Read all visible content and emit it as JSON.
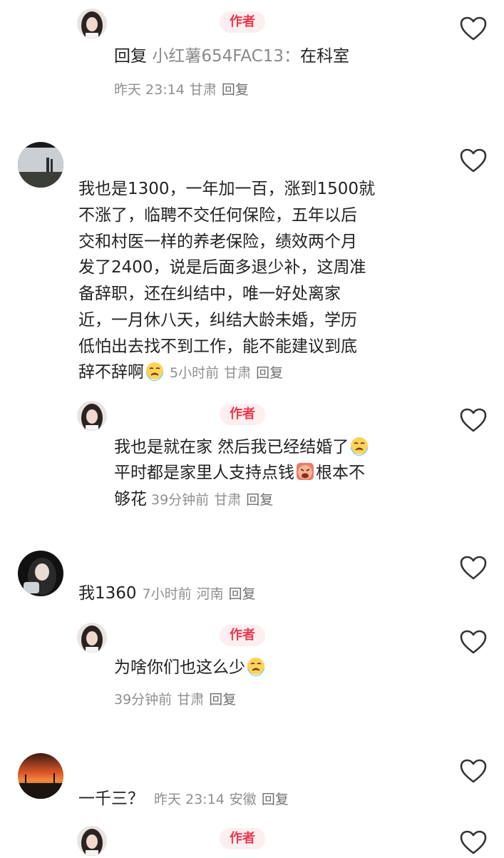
{
  "comments": [
    {
      "author_badge": "作者",
      "reply_prefix": "回复",
      "reply_target": "小红薯654FAC13：",
      "text": "在科室",
      "time": "昨天 23:14",
      "location": "甘肃",
      "reply_label": "回复"
    },
    {
      "lines": [
        "我也是1300，一年加一百，涨到1500就",
        "不涨了，临聘不交任何保险，五年以后",
        "交和村医一样的养老保险，绩效两个月",
        "发了2400，说是后面多退少补，这周准",
        "备辞职，还在纠结中，唯一好处离家",
        "近，一月休八天，纠结大龄未婚，学历",
        "低怕出去找不到工作，能不能建议到底"
      ],
      "last_line": "辞不辞啊",
      "emoji": "crying-face-emoji",
      "time": "5小时前",
      "location": "甘肃",
      "reply_label": "回复"
    },
    {
      "author_badge": "作者",
      "line1": "我也是就在家 然后我已经结婚了",
      "line2a": "平时都是家里人支持点钱",
      "line2b": "根本不",
      "line3": "够花",
      "time": "39分钟前",
      "location": "甘肃",
      "reply_label": "回复"
    },
    {
      "text": "我1360",
      "time": "7小时前",
      "location": "河南",
      "reply_label": "回复"
    },
    {
      "author_badge": "作者",
      "text": "为啥你们也这么少",
      "time": "39分钟前",
      "location": "甘肃",
      "reply_label": "回复"
    },
    {
      "text": "一千三？",
      "time": "昨天 23:14",
      "location": "安徽",
      "reply_label": "回复"
    },
    {
      "author_badge": "作者"
    }
  ],
  "colors": {
    "badge_text": "#e8394e",
    "badge_bg": "#fdeef0",
    "meta_text": "#8f8f8f",
    "body_text": "#222222"
  }
}
